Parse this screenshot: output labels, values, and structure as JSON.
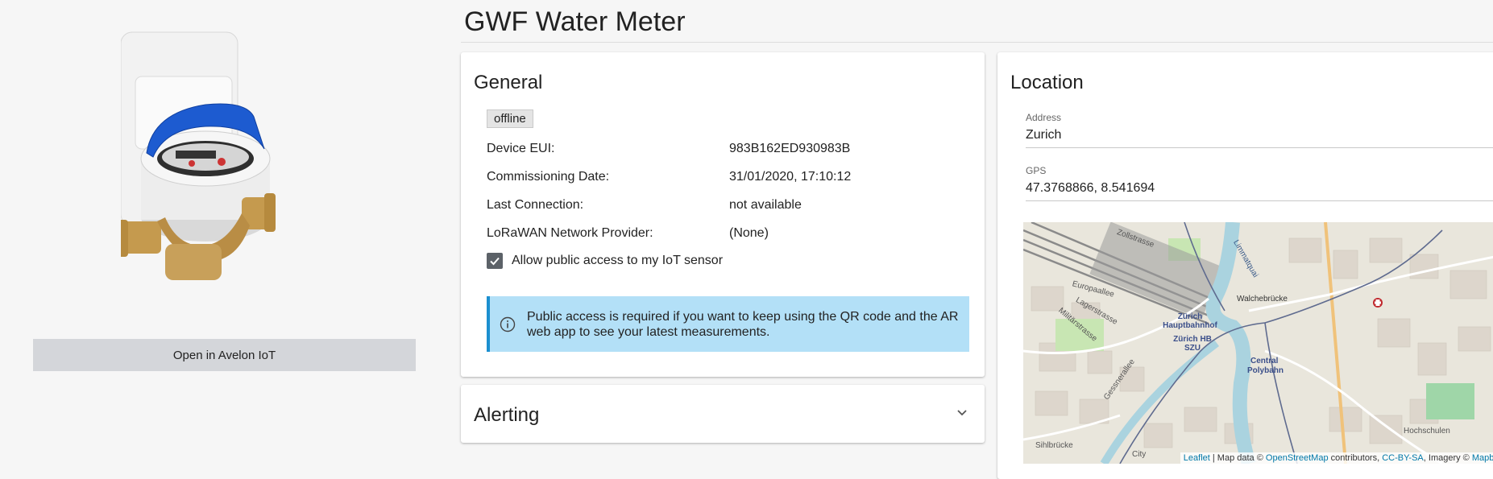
{
  "device_panel": {
    "image_icon": "water-meter-image",
    "open_button_label": "Open in Avelon IoT"
  },
  "page_title": "GWF Water Meter",
  "general": {
    "title": "General",
    "status_badge": "offline",
    "rows": [
      {
        "label": "Device EUI:",
        "value": "983B162ED930983B"
      },
      {
        "label": "Commissioning Date:",
        "value": "31/01/2020, 17:10:12"
      },
      {
        "label": "Last Connection:",
        "value": "not available"
      },
      {
        "label": "LoRaWAN Network Provider:",
        "value": "(None)"
      }
    ],
    "public_access_label": "Allow public access to my IoT sensor",
    "public_access_checked": true,
    "info_icon": "info-circle-icon",
    "info_text": "Public access is required if you want to keep using the QR code and the AR web app to see your latest measurements."
  },
  "alerting": {
    "title": "Alerting",
    "expand_icon": "chevron-down-icon"
  },
  "location": {
    "title": "Location",
    "address_label": "Address",
    "address_value": "Zurich",
    "gps_label": "GPS",
    "gps_value": "47.3768866, 8.541694",
    "map": {
      "streets": [
        "Zollstrasse",
        "Europaallee",
        "Lagerstrasse",
        "Militärstrasse",
        "Gessnerallee",
        "Sihlbrücke",
        "Walchebrücke",
        "Limmatquai",
        "Hochschulen",
        "City"
      ],
      "stations": [
        "Zürich Hauptbahnhof",
        "Zürich HB SZU",
        "Central",
        "Polybahn"
      ],
      "attribution": {
        "leaflet": "Leaflet",
        "map_data": "| Map data ©",
        "osm": "OpenStreetMap",
        "contributors": "contributors,",
        "license": "CC-BY-SA",
        "imagery": ", Imagery ©",
        "mapbox": "Mapbox"
      }
    }
  },
  "colors": {
    "accent_info_bg": "#b3e0f7",
    "accent_info_border": "#1b8fd0",
    "button_bg": "#d4d6da",
    "checkbox": "#5c6268",
    "meter_lid": "#1d5bd0"
  }
}
